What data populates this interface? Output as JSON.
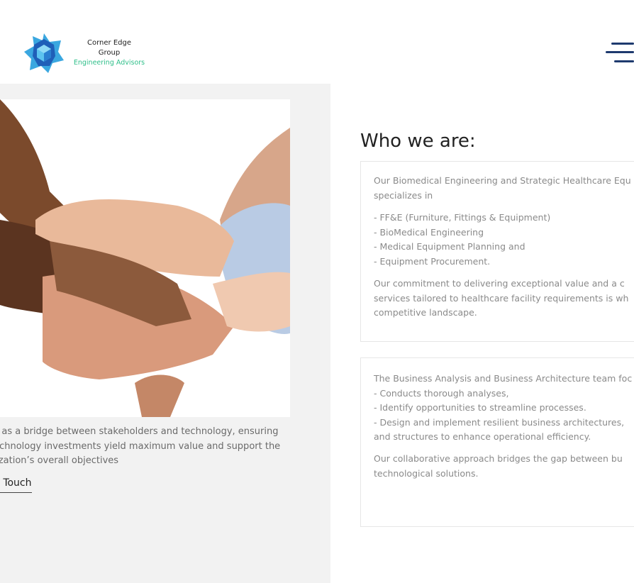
{
  "brand": {
    "line1": "Corner Edge",
    "line2": "Group",
    "tagline": "Engineering Advisors",
    "logo_icon": "star-cube-logo-icon",
    "colors": {
      "logo_blue": "#1f5fb8",
      "logo_cyan": "#3aa7e0",
      "tagline_green": "#2fbf8a",
      "menu_navy": "#1e3a6e"
    }
  },
  "nav": {
    "menu_icon": "hamburger-menu-icon"
  },
  "hero": {
    "image_alt": "stacked-hands-photo",
    "lines": [
      "ct as a bridge between stakeholders and technology, ensuring",
      "technology investments yield maximum value and support the",
      "nization’s overall objectives"
    ],
    "cta": "n Touch"
  },
  "about": {
    "title": "Who we are:",
    "card1": {
      "intro": [
        "Our Biomedical Engineering and Strategic Healthcare Equ",
        "specializes in"
      ],
      "list": [
        "- FF&E (Furniture, Fittings & Equipment)",
        "- BioMedical Engineering",
        "- Medical Equipment Planning and",
        "- Equipment Procurement."
      ],
      "outro": [
        "Our commitment to delivering exceptional value and a c",
        "services tailored to healthcare facility requirements is wh",
        "competitive landscape."
      ]
    },
    "card2": {
      "intro": [
        "The Business Analysis and Business Architecture team foc",
        "- Conducts thorough analyses,",
        "- Identify opportunities to streamline processes.",
        "- Design and implement resilient business architectures,",
        "and structures to enhance operational efficiency."
      ],
      "outro": [
        "Our collaborative approach bridges the gap between bu",
        "technological solutions."
      ]
    }
  }
}
